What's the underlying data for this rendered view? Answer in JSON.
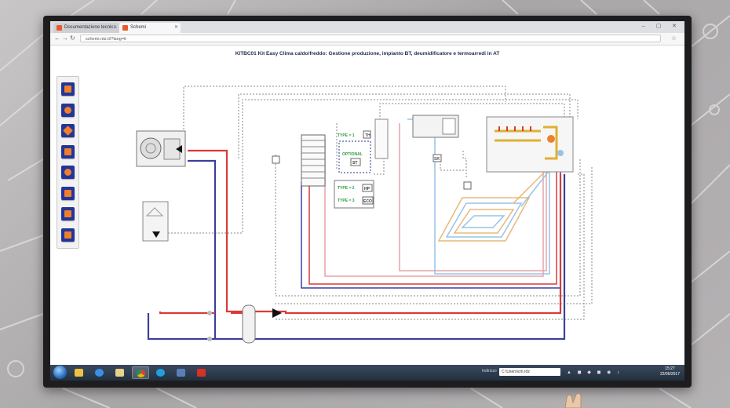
{
  "browser": {
    "tabs": [
      {
        "label": "Documentazione tecnic...",
        "active": false
      },
      {
        "label": "Schemi",
        "active": true
      }
    ],
    "url": "schemi.rdz.it/?lang=it",
    "window_controls": "– ▢ ✕"
  },
  "page": {
    "title": "KITBC01 Kit Easy Clima caldo/freddo: Gestione produzione, impianto BT, deumidificatore e termoarredi in AT"
  },
  "toolbar": {
    "buttons": [
      "icon-1",
      "icon-2",
      "icon-3",
      "icon-4",
      "icon-5",
      "icon-6",
      "icon-7",
      "icon-8"
    ]
  },
  "diagram": {
    "labels": {
      "type1": "TYPE = 1",
      "type2": "TYPE = 2",
      "type3": "TYPE = 3",
      "optional": "OPTIONAL",
      "st": "ST",
      "th": "TH",
      "hp": "HP",
      "eco": "ECO",
      "sr": "SR"
    }
  },
  "taskbar": {
    "indirizzo_label": "Indirizzo",
    "address_value": "C:\\Users\\cm.rdz",
    "time": "15:27",
    "date": "22/06/2017"
  },
  "colors": {
    "flow": "#d83a3a",
    "return": "#3b3f9e",
    "pale_red": "#e8a3a8",
    "pale_blue": "#97c4e6",
    "floor_orange": "#e8b87a",
    "signal_dash": "#888888",
    "toolbar_blue": "#23359a",
    "toolbar_orange": "#ef7f2a",
    "label_green": "#2e9b3e"
  }
}
